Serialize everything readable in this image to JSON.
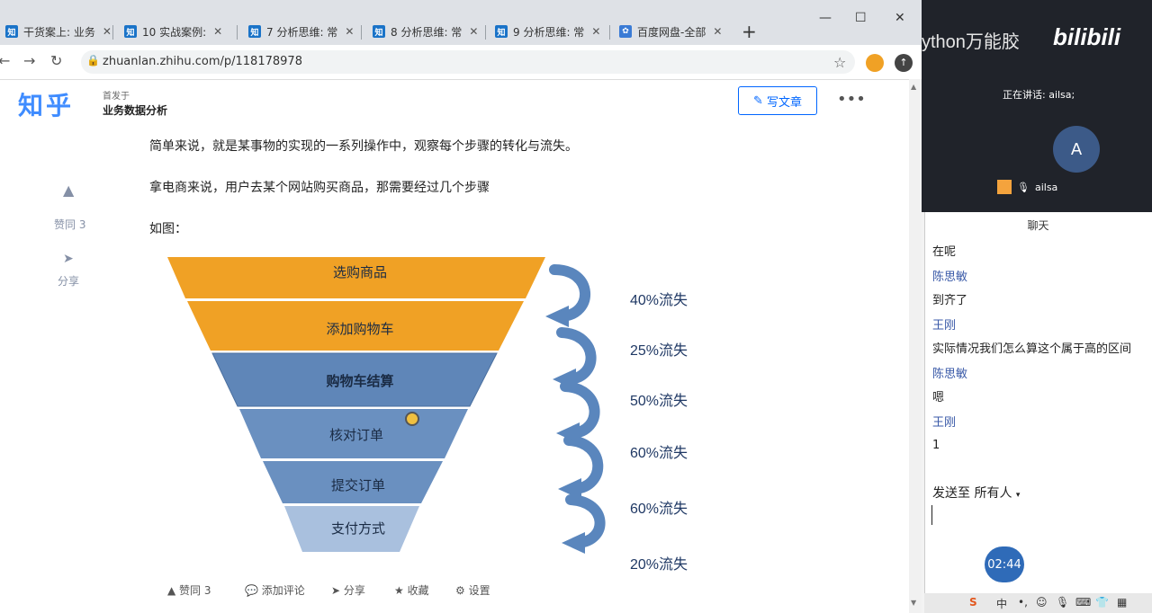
{
  "tabs": [
    {
      "icon": "知",
      "label": "干货案上: 业务"
    },
    {
      "icon": "知",
      "label": "10 实战案例: "
    },
    {
      "icon": "知",
      "label": "7 分析思维: 常"
    },
    {
      "icon": "知",
      "label": "8 分析思维: 常"
    },
    {
      "icon": "知",
      "label": "9 分析思维: 常"
    },
    {
      "icon": "✿",
      "label": "百度网盘-全部"
    }
  ],
  "browser": {
    "url": "zhuanlan.zhihu.com/p/118178978",
    "new_tab": "+",
    "min": "—",
    "max": "☐",
    "close": "✕"
  },
  "zhihu": {
    "logo": "知乎",
    "published_in": "首发于",
    "column": "业务数据分析",
    "write_button": "写文章",
    "more": "•••"
  },
  "article": {
    "p1": "简单来说，就是某事物的实现的一系列操作中，观察每个步骤的转化与流失。",
    "p2": "拿电商来说，用户去某个网站购买商品，那需要经过几个步骤",
    "p3": "如图："
  },
  "sidebar": {
    "vote_label": "赞同 3",
    "share_label": "分享"
  },
  "funnel": {
    "stages": [
      "选购商品",
      "添加购物车",
      "购物车结算",
      "核对订单",
      "提交订单",
      "支付方式"
    ],
    "losses": [
      "40%流失",
      "25%流失",
      "50%流失",
      "60%流失",
      "60%流失",
      "20%流失"
    ]
  },
  "bottom_bar": {
    "vote": "赞同 3",
    "comment": "添加评论",
    "share": "分享",
    "collect": "收藏",
    "settings": "设置"
  },
  "overlay": {
    "brand_text": "ython万能胶",
    "bilibili_logo": "bilibili",
    "speaking": "正在讲话: ailsa;",
    "avatar_letter": "A",
    "mic_user": "ailsa"
  },
  "chat": {
    "title": "聊天",
    "messages": [
      {
        "type": "text",
        "text": "在呢"
      },
      {
        "type": "name",
        "text": "陈思敏"
      },
      {
        "type": "text",
        "text": "到齐了"
      },
      {
        "type": "name",
        "text": "王刚"
      },
      {
        "type": "text",
        "text": "实际情况我们怎么算这个属于高的区间"
      },
      {
        "type": "name",
        "text": "陈思敏"
      },
      {
        "type": "text",
        "text": "嗯"
      },
      {
        "type": "name",
        "text": "王刚"
      },
      {
        "type": "text",
        "text": "1"
      }
    ],
    "send_to": "发送至",
    "recipient": "所有人",
    "timer": "02:44"
  },
  "taskbar": {
    "ime": "中"
  },
  "colors": {
    "funnel_orange": "#f0a125",
    "funnel_blue": "#6a90c0",
    "funnel_light": "#a9c0de",
    "arrow": "#5a86bd"
  }
}
